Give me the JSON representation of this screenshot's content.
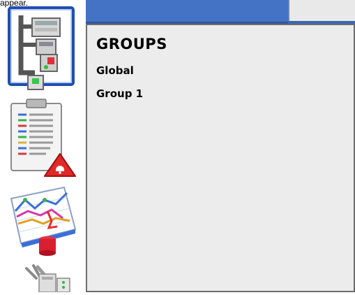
{
  "top_clip": "appear.",
  "sidebar": {
    "items": [
      {
        "icon": "network-diagram-icon"
      },
      {
        "icon": "alarm-checklist-icon"
      },
      {
        "icon": "trend-chart-database-icon"
      },
      {
        "icon": "tools-device-icon"
      }
    ]
  },
  "groups_panel": {
    "title": "GROUPS",
    "items": [
      {
        "label": "Global"
      },
      {
        "label": "Group 1"
      }
    ]
  },
  "colors": {
    "tab_active": "#4472c4",
    "tab_inactive": "#e9e9e9",
    "panel_bg": "#ececec",
    "panel_border": "#6d6d6d"
  }
}
